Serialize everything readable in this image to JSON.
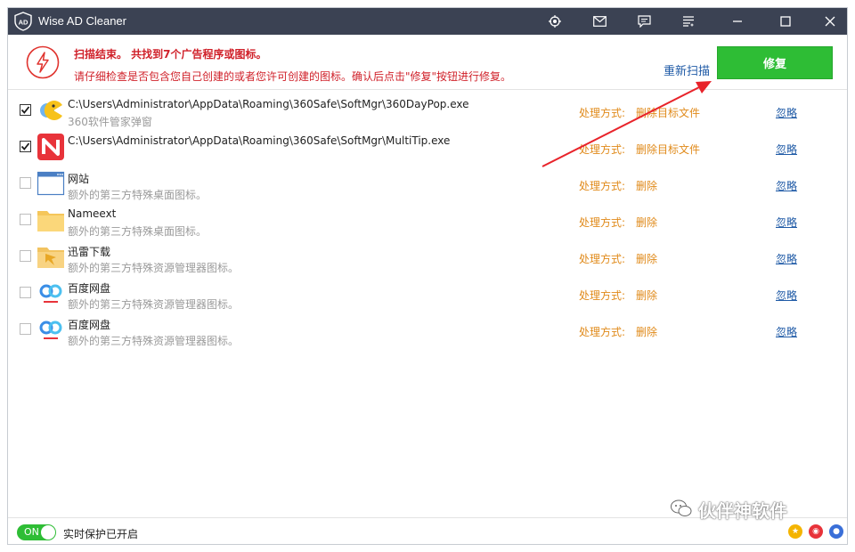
{
  "window": {
    "title": "Wise AD Cleaner"
  },
  "titlebar_icons": [
    "target-icon",
    "mail-icon",
    "chat-icon",
    "menu-icon",
    "minimize-icon",
    "maximize-icon",
    "close-icon"
  ],
  "scan": {
    "line1": "扫描结束。 共找到7个广告程序或图标。",
    "line2": "请仔细检查是否包含您自己创建的或者您许可创建的图标。确认后点击\"修复\"按钮进行修复。",
    "rescan_label": "重新扫描",
    "fix_label": "修复"
  },
  "items": [
    {
      "checked": true,
      "icon": "pacman-icon",
      "title": "C:\\Users\\Administrator\\AppData\\Roaming\\360Safe\\SoftMgr\\360DayPop.exe",
      "subtitle": "360软件管家弹窗",
      "mode_label": "处理方式:",
      "action": "删除目标文件",
      "ignore": "忽略"
    },
    {
      "checked": true,
      "icon": "n-app-icon",
      "title": "C:\\Users\\Administrator\\AppData\\Roaming\\360Safe\\SoftMgr\\MultiTip.exe",
      "subtitle": "",
      "mode_label": "处理方式:",
      "action": "删除目标文件",
      "ignore": "忽略"
    },
    {
      "checked": false,
      "icon": "website-icon",
      "title": "网站",
      "subtitle": "额外的第三方特殊桌面图标。",
      "mode_label": "处理方式:",
      "action": "删除",
      "ignore": "忽略"
    },
    {
      "checked": false,
      "icon": "folder-icon",
      "title": "Nameext",
      "subtitle": "额外的第三方特殊桌面图标。",
      "mode_label": "处理方式:",
      "action": "删除",
      "ignore": "忽略"
    },
    {
      "checked": false,
      "icon": "thunder-icon",
      "title": "迅雷下载",
      "subtitle": "额外的第三方特殊资源管理器图标。",
      "mode_label": "处理方式:",
      "action": "删除",
      "ignore": "忽略"
    },
    {
      "checked": false,
      "icon": "baidu-pan-icon",
      "title": "百度网盘",
      "subtitle": "额外的第三方特殊资源管理器图标。",
      "mode_label": "处理方式:",
      "action": "删除",
      "ignore": "忽略"
    },
    {
      "checked": false,
      "icon": "baidu-pan-icon",
      "title": "百度网盘",
      "subtitle": "额外的第三方特殊资源管理器图标。",
      "mode_label": "处理方式:",
      "action": "删除",
      "ignore": "忽略"
    }
  ],
  "footer": {
    "toggle_label": "ON",
    "toggle_on": true,
    "protection_text": "实时保护已开启"
  },
  "watermark": "伙伴神软件",
  "colors": {
    "titlebar": "#3b4253",
    "fix_button": "#2ebd35",
    "warning_text": "#d0212a",
    "action_text": "#e08a1a",
    "link": "#1f5aa6"
  }
}
